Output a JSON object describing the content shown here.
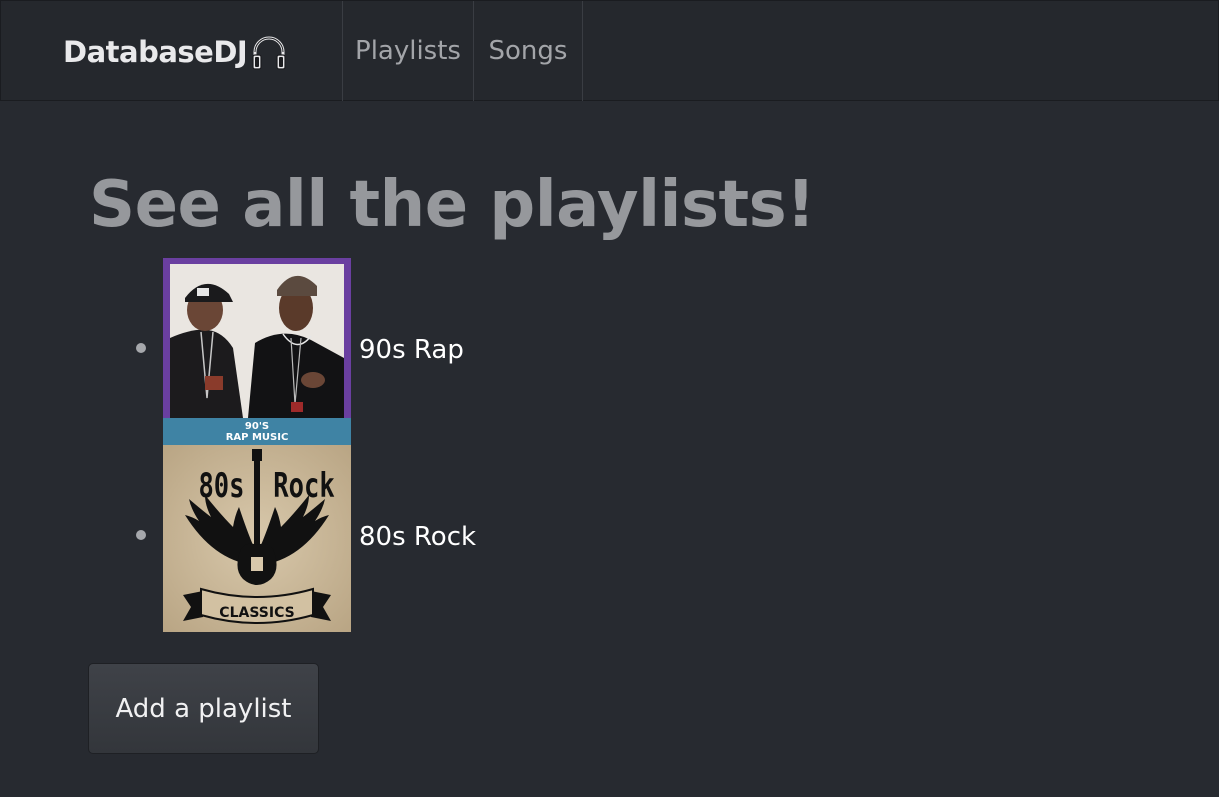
{
  "navbar": {
    "brand": "DatabaseDJ",
    "brand_icon": "headphones-icon",
    "links": [
      {
        "label": "Playlists"
      },
      {
        "label": "Songs"
      }
    ]
  },
  "main": {
    "title": "See all the playlists!",
    "playlists": [
      {
        "name": "90s Rap",
        "cover": {
          "caption_line1": "90'S",
          "caption_line2": "RAP MUSIC",
          "frame_color": "#6a3fa0",
          "banner_color": "#3f83a4"
        }
      },
      {
        "name": "80s Rock",
        "cover": {
          "text_left": "80s",
          "text_right": "Rock",
          "banner_text": "CLASSICS",
          "background_color": "#cbb89a"
        }
      }
    ],
    "add_button_label": "Add a playlist"
  }
}
